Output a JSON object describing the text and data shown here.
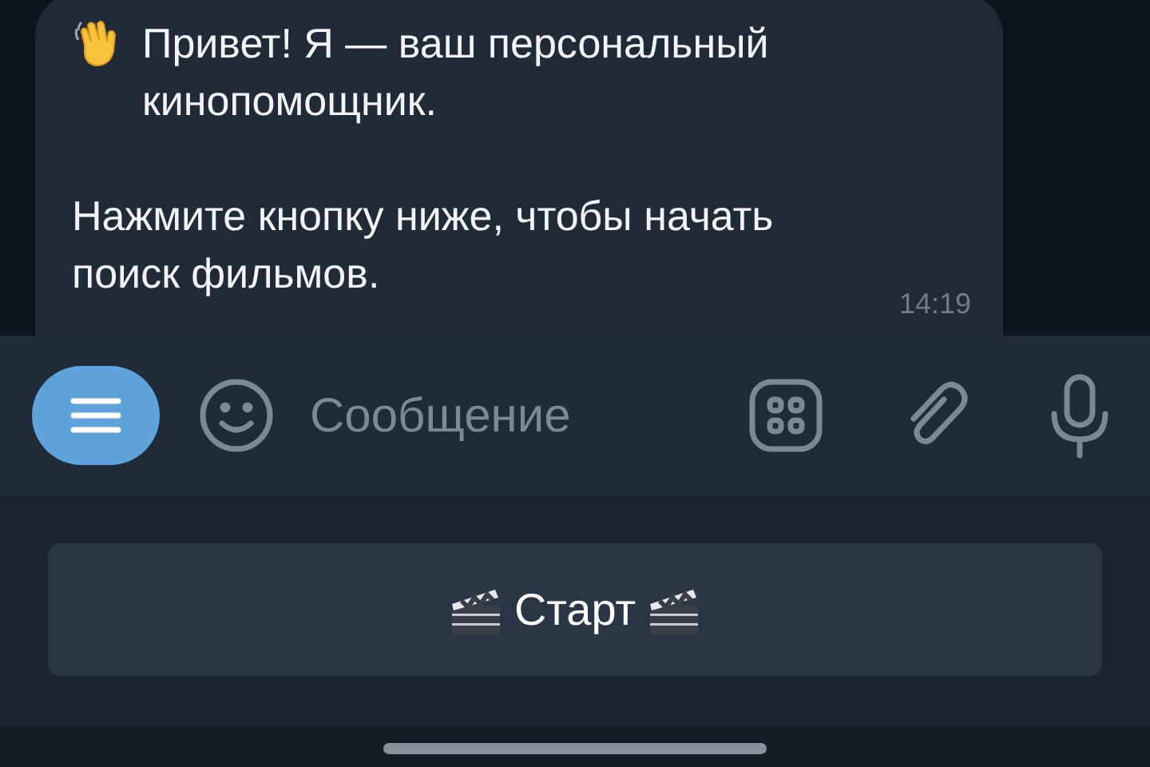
{
  "message": {
    "paragraphs": [
      {
        "kind": "greeting",
        "lines": [
          "Привет! Я — ваш персональный",
          "кинопомощник."
        ]
      },
      {
        "kind": "plain",
        "lines": [
          "Нажмите кнопку ниже, чтобы начать",
          "поиск фильмов."
        ]
      }
    ],
    "time": "14:19"
  },
  "composer": {
    "placeholder": "Сообщение"
  },
  "keyboard": {
    "buttons": [
      {
        "label": "Старт"
      }
    ]
  }
}
